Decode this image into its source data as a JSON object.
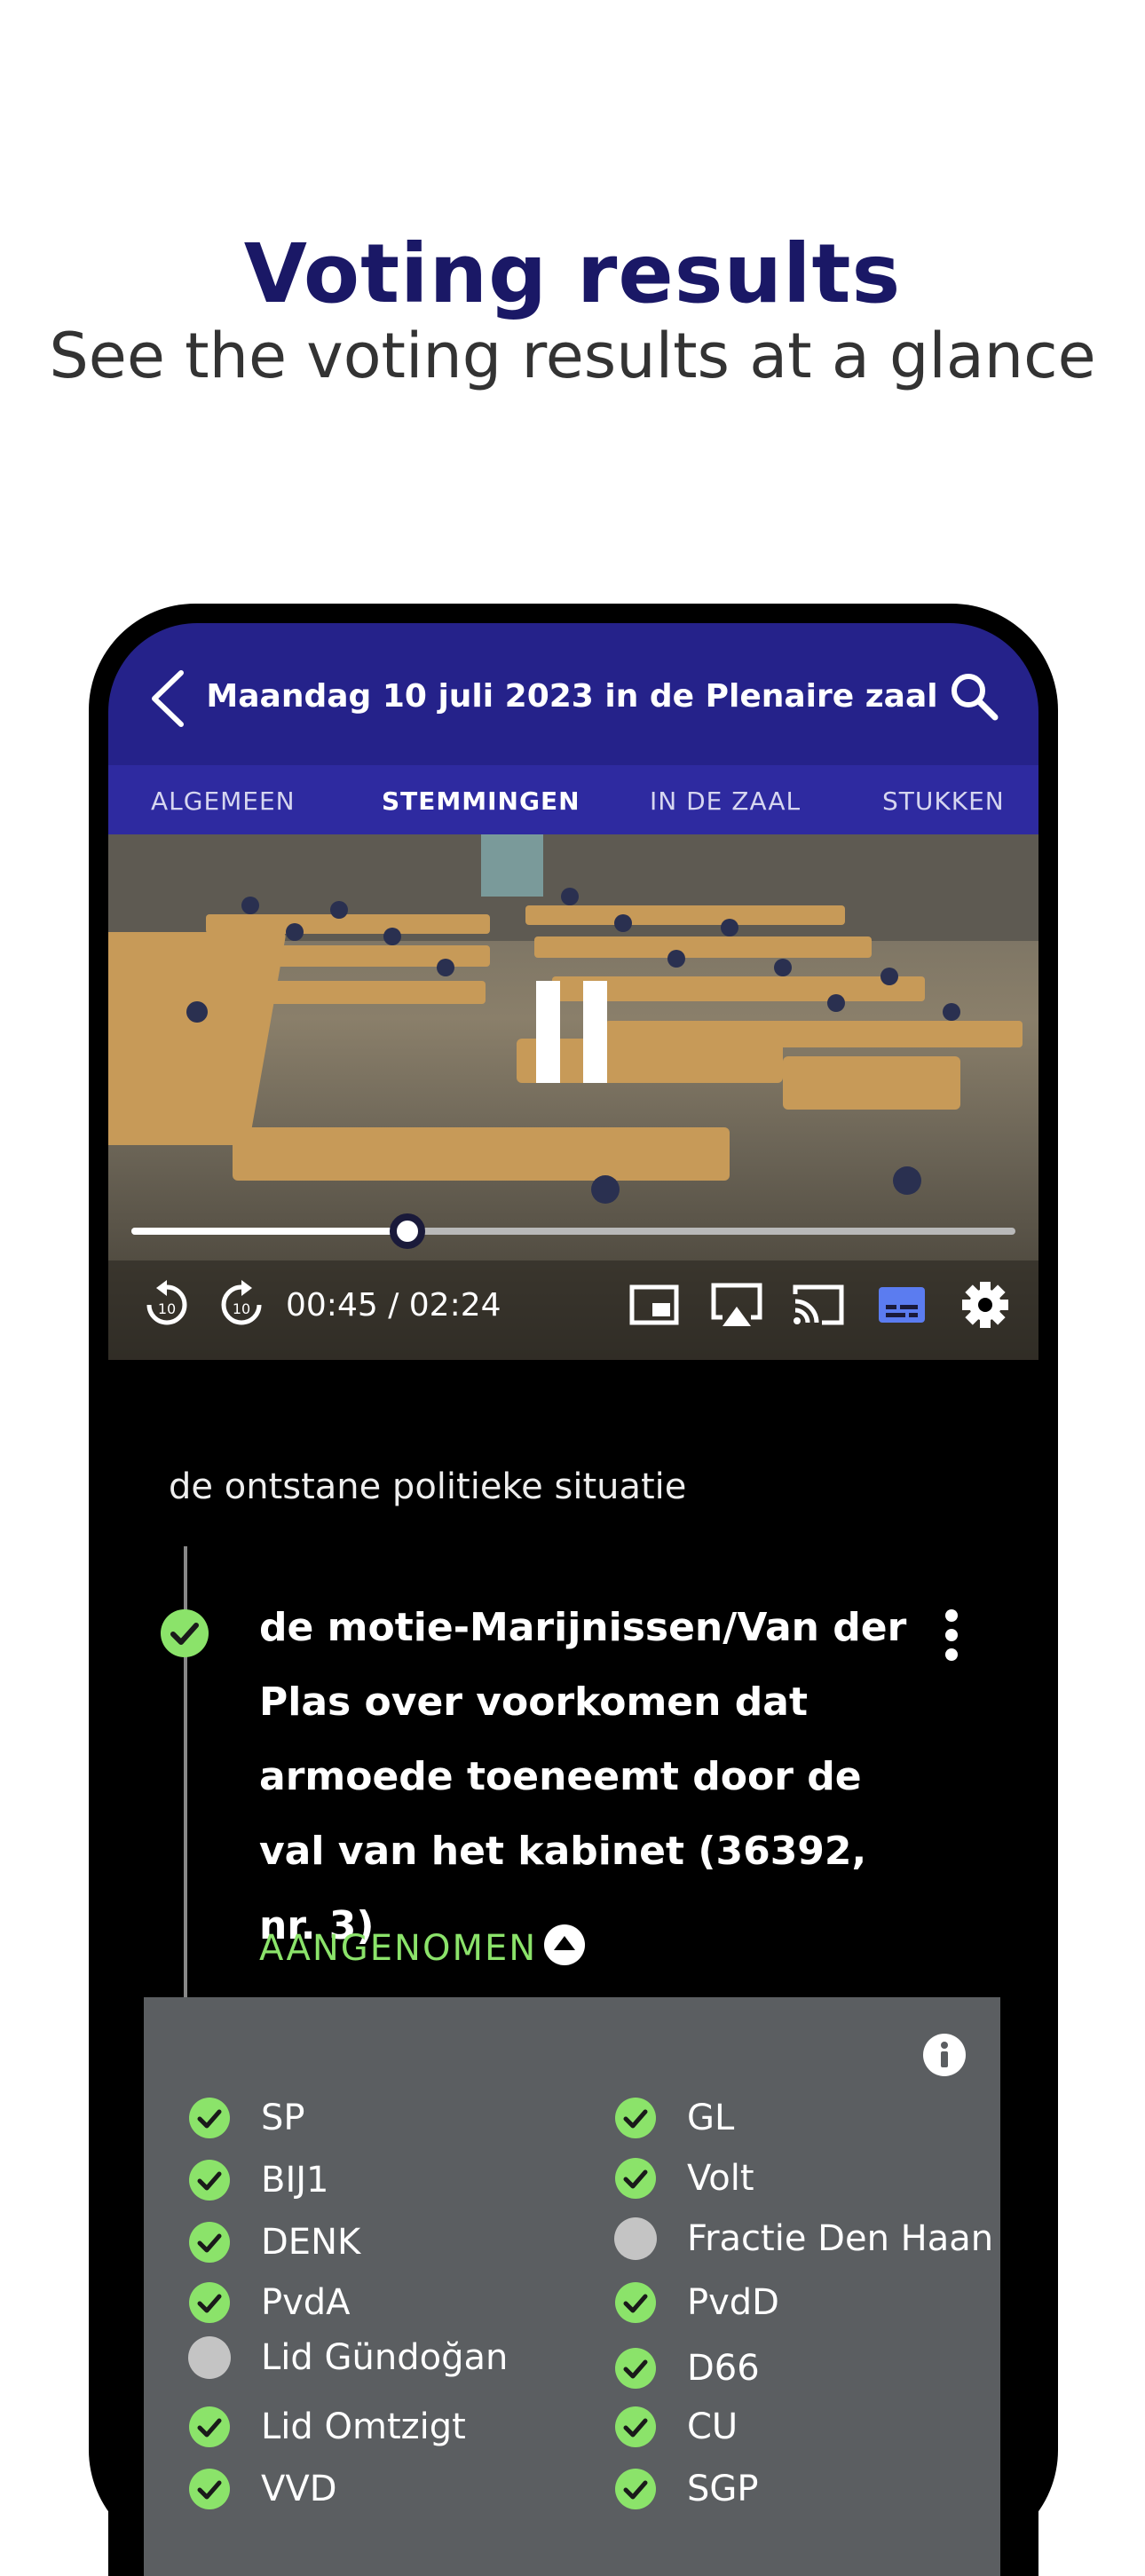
{
  "promo": {
    "title": "Voting results",
    "subtitle": "See the voting results at a glance"
  },
  "header": {
    "title": "Maandag 10 juli 2023 in de Plenaire zaal",
    "back_icon": "chevron-left-icon",
    "search_icon": "search-icon"
  },
  "tabs": [
    {
      "label": "ALGEMEEN",
      "active": false
    },
    {
      "label": "STEMMINGEN",
      "active": true
    },
    {
      "label": "IN DE ZAAL",
      "active": false
    },
    {
      "label": "STUKKEN",
      "active": false
    }
  ],
  "player": {
    "state": "playing",
    "time": "00:45 / 02:24",
    "progress": 0.312,
    "controls": [
      "replay-10-icon",
      "forward-10-icon",
      "picture-in-picture-icon",
      "airplay-icon",
      "cast-icon",
      "subtitles-icon",
      "settings-icon"
    ],
    "accent": "#5b7cf0"
  },
  "agenda": {
    "section": "de ontstane politieke situatie",
    "motion": "de motie-Marijnissen/Van der Plas over voorkomen dat armoede toeneemt door de val van het kabinet (36392, nr. 3)",
    "result": "AANGENOMEN",
    "result_color": "#8be36a"
  },
  "votes": {
    "left": [
      {
        "party": "SP",
        "vote": "for"
      },
      {
        "party": "BIJ1",
        "vote": "for"
      },
      {
        "party": "DENK",
        "vote": "for"
      },
      {
        "party": "PvdA",
        "vote": "for"
      },
      {
        "party": "Lid Gündoğan",
        "vote": "absent"
      },
      {
        "party": "Lid Omtzigt",
        "vote": "for"
      },
      {
        "party": "VVD",
        "vote": "for"
      }
    ],
    "right": [
      {
        "party": "GL",
        "vote": "for"
      },
      {
        "party": "Volt",
        "vote": "for"
      },
      {
        "party": "Fractie Den Haan",
        "vote": "absent"
      },
      {
        "party": "PvdD",
        "vote": "for"
      },
      {
        "party": "D66",
        "vote": "for"
      },
      {
        "party": "CU",
        "vote": "for"
      },
      {
        "party": "SGP",
        "vote": "for"
      }
    ],
    "for_color": "#8be36a",
    "absent_color": "#c4c4c4"
  }
}
